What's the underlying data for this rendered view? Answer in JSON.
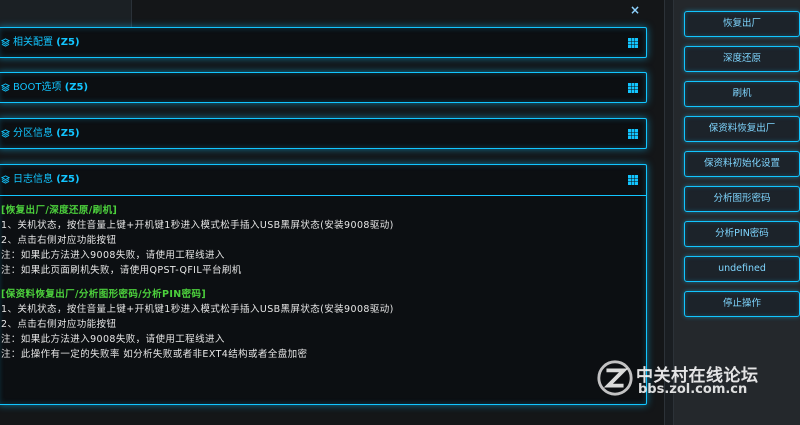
{
  "window": {
    "close_glyph": "×"
  },
  "panels": [
    {
      "title": "相关配置",
      "tag": "(Z5)"
    },
    {
      "title": "BOOT选项",
      "tag": "(Z5)"
    },
    {
      "title": "分区信息",
      "tag": "(Z5)"
    },
    {
      "title": "日志信息",
      "tag": "(Z5)"
    }
  ],
  "log": {
    "sections": [
      {
        "heading": "[恢复出厂/深度还原/刷机]",
        "lines": [
          "1、关机状态，按住音量上键+开机键1秒进入模式松手插入USB黑屏状态(安装9008驱动)",
          "2、点击右侧对应功能按钮",
          "注：如果此方法进入9008失败，请使用工程线进入",
          "注：如果此页面刷机失败，请使用QPST-QFIL平台刷机"
        ]
      },
      {
        "heading": "[保资料恢复出厂/分析图形密码/分析PIN密码]",
        "lines": [
          "1、关机状态，按住音量上键+开机键1秒进入模式松手插入USB黑屏状态(安装9008驱动)",
          "2、点击右侧对应功能按钮",
          "注：如果此方法进入9008失败，请使用工程线进入",
          "注：此操作有一定的失败率 如分析失败或者非EXT4结构或者全盘加密"
        ]
      }
    ]
  },
  "sidebar": {
    "buttons": [
      "恢复出厂",
      "深度还原",
      "刷机",
      "保资料恢复出厂",
      "保资料初始化设置",
      "分析图形密码",
      "分析PIN密码",
      "undefined",
      "停止操作"
    ]
  },
  "watermark": {
    "name": "中关村在线论坛",
    "url": "bbs.zol.com.cn"
  },
  "colors": {
    "accent": "#12c5ff",
    "heading_green": "#4cd03c",
    "text": "#e6e6e6"
  }
}
